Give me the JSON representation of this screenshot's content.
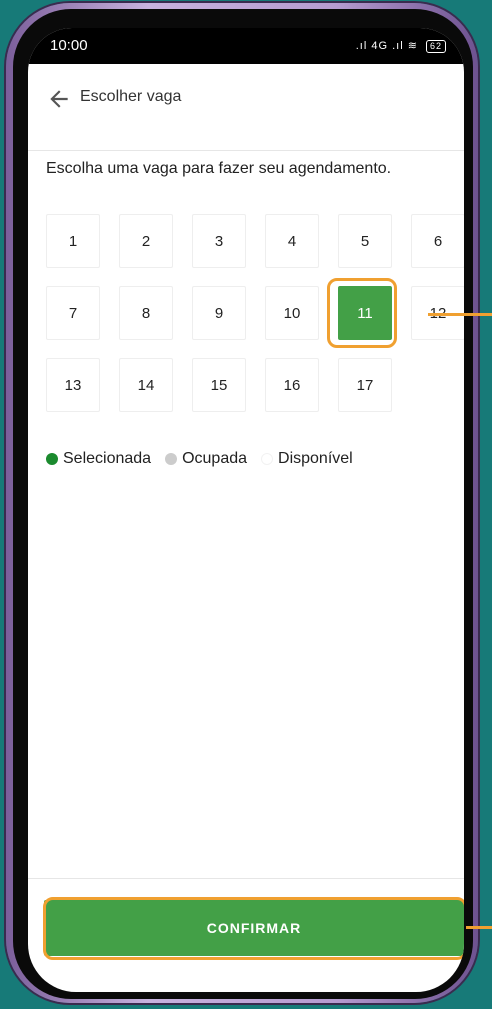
{
  "status_bar": {
    "time": "10:00",
    "signal_text": ".ıl 4G .ıl",
    "battery_level": "62"
  },
  "app_bar": {
    "back_icon": "arrow-left-icon",
    "title": "Escolher vaga"
  },
  "instruction": "Escolha uma vaga para fazer seu agendamento.",
  "slots": [
    {
      "label": "1",
      "state": "available"
    },
    {
      "label": "2",
      "state": "available"
    },
    {
      "label": "3",
      "state": "available"
    },
    {
      "label": "4",
      "state": "available"
    },
    {
      "label": "5",
      "state": "available"
    },
    {
      "label": "6",
      "state": "available"
    },
    {
      "label": "7",
      "state": "available"
    },
    {
      "label": "8",
      "state": "available"
    },
    {
      "label": "9",
      "state": "available"
    },
    {
      "label": "10",
      "state": "available"
    },
    {
      "label": "11",
      "state": "selected"
    },
    {
      "label": "12",
      "state": "available"
    },
    {
      "label": "13",
      "state": "available"
    },
    {
      "label": "14",
      "state": "available"
    },
    {
      "label": "15",
      "state": "available"
    },
    {
      "label": "16",
      "state": "available"
    },
    {
      "label": "17",
      "state": "available"
    }
  ],
  "legend": {
    "selected": {
      "label": "Selecionada",
      "color": "#1b8a2e"
    },
    "occupied": {
      "label": "Ocupada",
      "color": "#cccccc"
    },
    "available": {
      "label": "Disponível",
      "color": "#ffffff"
    }
  },
  "confirm_button": {
    "label": "CONFIRMAR",
    "color": "#43a047"
  },
  "colors": {
    "accent": "#43a047",
    "highlight": "#f0a030",
    "background": "#177a78"
  }
}
